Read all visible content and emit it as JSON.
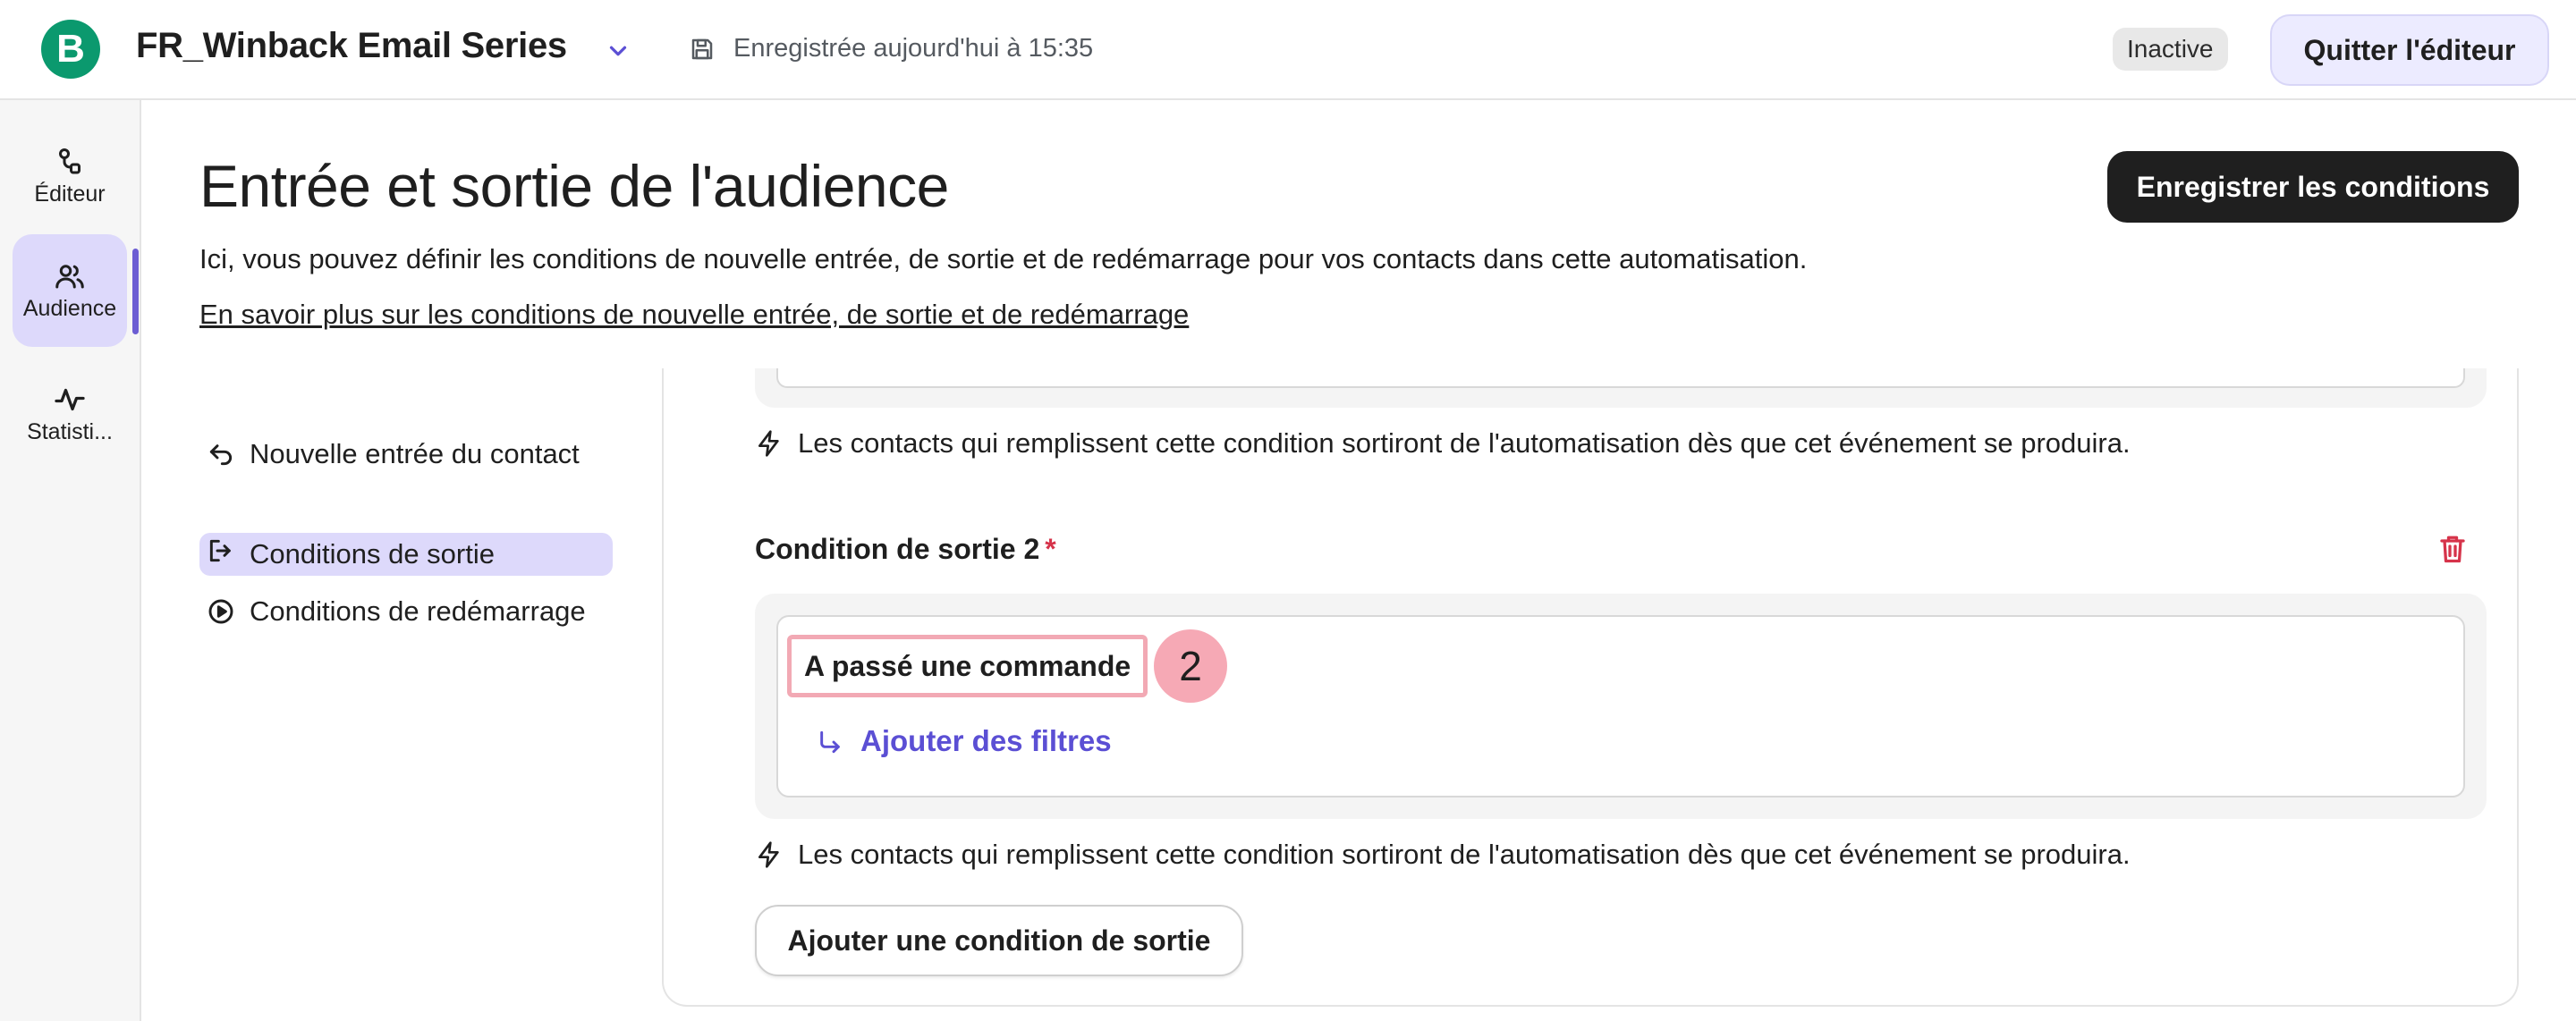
{
  "header": {
    "logo_letter": "B",
    "automation_title": "FR_Winback Email Series",
    "saved_status": "Enregistrée aujourd'hui à 15:35",
    "status_badge": "Inactive",
    "quit_label": "Quitter l'éditeur"
  },
  "rail": {
    "items": [
      {
        "label": "Éditeur",
        "icon": "workflow-icon"
      },
      {
        "label": "Audience",
        "icon": "users-icon"
      },
      {
        "label": "Statisti...",
        "icon": "activity-icon"
      }
    ],
    "active": "Audience"
  },
  "page": {
    "title": "Entrée et sortie de l'audience",
    "save_button": "Enregistrer les conditions",
    "description": "Ici, vous pouvez définir les conditions de nouvelle entrée, de sortie et de redémarrage pour vos contacts dans cette automatisation.",
    "learn_more": "En savoir plus sur les conditions de nouvelle entrée, de sortie et de redémarrage"
  },
  "subnav": {
    "items": [
      {
        "label": "Nouvelle entrée du contact",
        "icon": "undo-arrow-icon"
      },
      {
        "label": "Conditions de sortie",
        "icon": "exit-icon"
      },
      {
        "label": "Conditions de redémarrage",
        "icon": "play-circle-icon"
      }
    ],
    "active": "Conditions de sortie"
  },
  "conditions": {
    "info_text": "Les contacts qui remplissent cette condition sortiront de l'automatisation dès que cet événement se produira.",
    "condition_2": {
      "title": "Condition de sortie 2",
      "required_mark": "*",
      "event": "A passé une commande",
      "step_number": "2",
      "add_filters": "Ajouter des filtres"
    },
    "add_condition_button": "Ajouter une condition de sortie"
  },
  "colors": {
    "accent": "#6c5dd3",
    "link_purple": "#5b4fd4",
    "logo_green": "#0b996e",
    "delete_red": "#d6334a",
    "highlight_pink": "#f2a9b4"
  }
}
